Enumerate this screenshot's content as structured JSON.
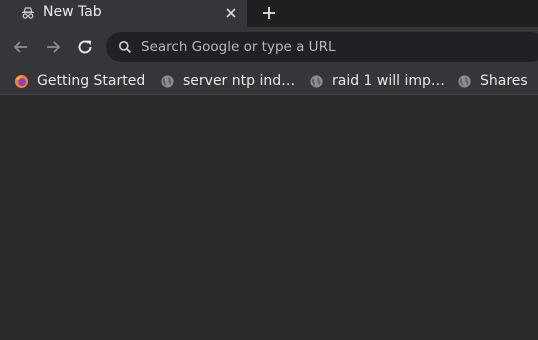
{
  "tab": {
    "title": "New Tab",
    "favicon": "incognito-icon",
    "close_icon": "close-icon"
  },
  "new_tab_icon": "plus-icon",
  "toolbar": {
    "back_icon": "back-arrow-icon",
    "forward_icon": "forward-arrow-icon",
    "reload_icon": "reload-icon",
    "omnibox": {
      "placeholder": "Search Google or type a URL",
      "value": "",
      "icon": "search-icon"
    }
  },
  "bookmarks": [
    {
      "label": "Getting Started",
      "icon": "firefox-icon"
    },
    {
      "label": "server ntp ind…",
      "icon": "globe-icon"
    },
    {
      "label": "raid 1 will imp…",
      "icon": "globe-icon"
    },
    {
      "label": "Shares",
      "icon": "globe-icon"
    }
  ],
  "colors": {
    "background": "#2b2b2b",
    "toolbar": "#35363a",
    "tabstrip": "#1f1f1f",
    "omnibox": "#202124"
  }
}
